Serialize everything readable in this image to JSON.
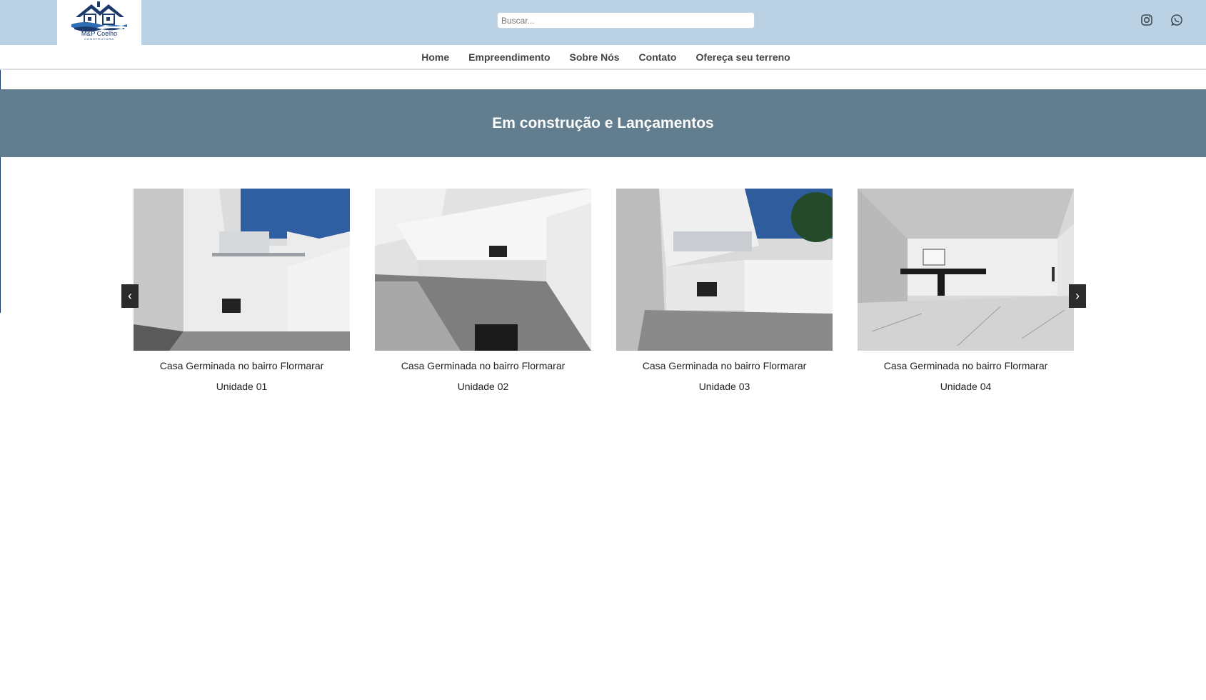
{
  "header": {
    "logo_text": "M&P Coelho",
    "logo_subtext": "CONSTRUTORA",
    "search_placeholder": "Buscar...",
    "social": [
      "instagram-icon",
      "whatsapp-icon"
    ]
  },
  "nav": {
    "items": [
      {
        "label": "Home"
      },
      {
        "label": "Empreendimento"
      },
      {
        "label": "Sobre Nós"
      },
      {
        "label": "Contato"
      },
      {
        "label": "Ofereça seu terreno"
      }
    ]
  },
  "section": {
    "title": "Em construção e Lançamentos"
  },
  "carousel": {
    "prev_label": "‹",
    "next_label": "›",
    "cards": [
      {
        "title": "Casa Germinada no bairro Flormarar",
        "unit": "Unidade 01"
      },
      {
        "title": "Casa Germinada no bairro Flormarar",
        "unit": "Unidade 02"
      },
      {
        "title": "Casa Germinada no bairro Flormarar",
        "unit": "Unidade 03"
      },
      {
        "title": "Casa Germinada no bairro Flormarar",
        "unit": "Unidade 04"
      }
    ]
  },
  "colors": {
    "topbar": "#bad2e3",
    "band": "#627d8d",
    "brand_navy": "#1c3a6b"
  }
}
